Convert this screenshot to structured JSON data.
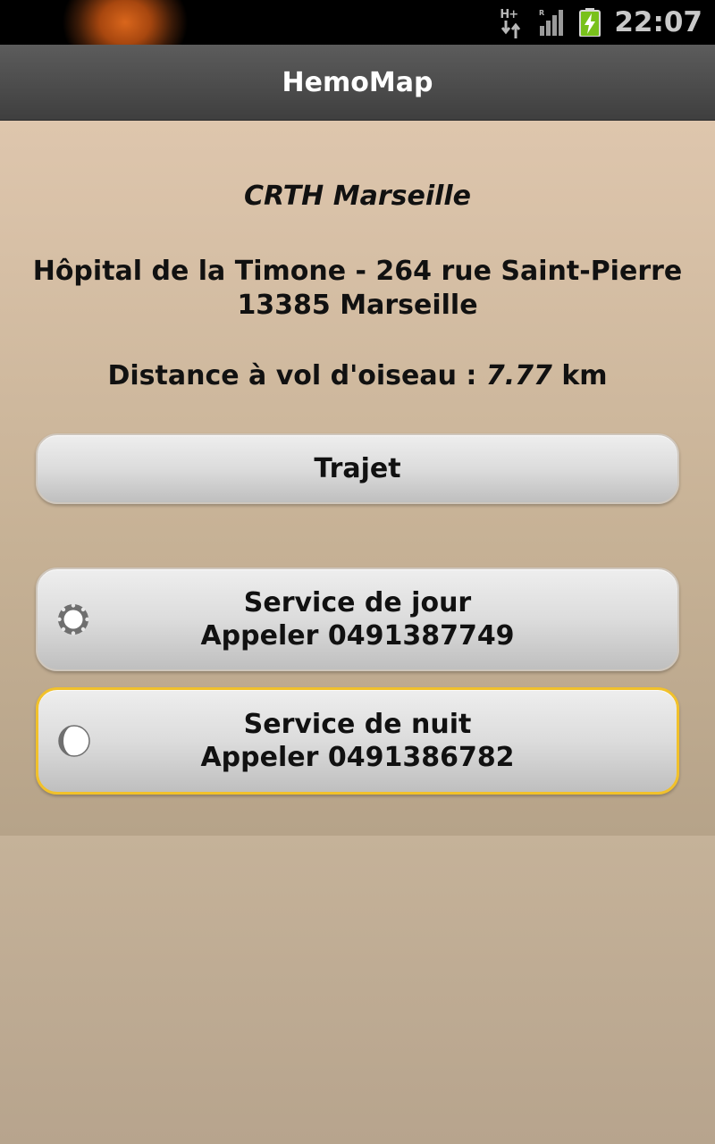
{
  "status_bar": {
    "network_label": "H+",
    "time": "22:07",
    "icons": [
      "notification-glow-icon",
      "hplus-data-icon",
      "signal-icon",
      "battery-charging-icon"
    ]
  },
  "app": {
    "title": "HemoMap"
  },
  "center": {
    "name": "CRTH Marseille",
    "address_line1": "Hôpital de la Timone - 264 rue Saint-Pierre",
    "address_line2": "13385 Marseille",
    "distance_label": "Distance à vol d'oiseau : ",
    "distance_value": "7.77",
    "distance_unit": "km"
  },
  "buttons": {
    "route_label": "Trajet",
    "day_service": {
      "title": "Service de jour",
      "call_label": "Appeler 0491387749",
      "icon": "sun-icon"
    },
    "night_service": {
      "title": "Service de nuit",
      "call_label": "Appeler 0491386782",
      "icon": "moon-icon"
    }
  },
  "colors": {
    "background_top": "#dec6ad",
    "background_bottom": "#b7a48d",
    "title_bar": "#4a4a4a",
    "focus_border": "#f1c12b"
  }
}
